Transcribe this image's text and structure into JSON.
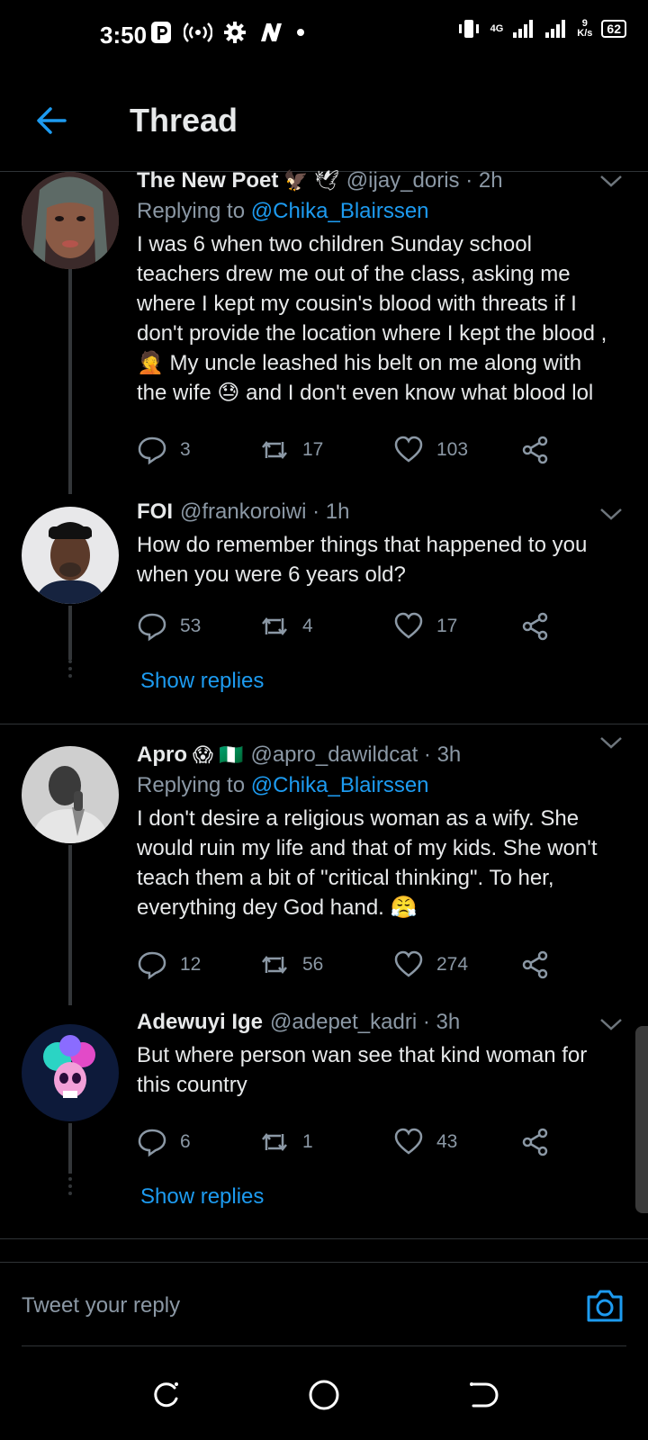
{
  "status_bar": {
    "time": "3:50",
    "left_icons": [
      "p-app-icon",
      "hotspot-icon",
      "settings-icon",
      "n-app-icon",
      "dot"
    ],
    "network": "4G",
    "speed_value": "9",
    "speed_unit": "K/s",
    "battery": "62"
  },
  "header": {
    "title": "Thread"
  },
  "tweets": [
    {
      "name": "The New Poet",
      "badges": "🦅 🕊",
      "handle": "@ijay_doris · 2h",
      "replying_prefix": "Replying to ",
      "replying_to": "@Chika_Blairssen",
      "text_lines": [
        "I was 6 when two children Sunday school",
        "teachers drew me out of the class, asking me",
        "where I kept my cousin's blood with threats if I",
        "don't provide the location where I kept the blood ,",
        "🤦 My uncle leashed his belt on me along with",
        "the wife 😓 and I don't even know what blood lol"
      ],
      "replies": "3",
      "retweets": "17",
      "likes": "103"
    },
    {
      "name": "FOI",
      "badges": "",
      "handle": "@frankoroiwi · 1h",
      "text_lines": [
        "How do remember things that happened to you",
        "when you were 6 years old?"
      ],
      "replies": "53",
      "retweets": "4",
      "likes": "17",
      "show_replies": "Show replies"
    },
    {
      "name": "Apro",
      "badges": "😱 🇳🇬",
      "handle": "@apro_dawildcat · 3h",
      "replying_prefix": "Replying to ",
      "replying_to": "@Chika_Blairssen",
      "text_lines": [
        "I don't desire a religious woman as a wify. She",
        "would ruin my life and that of my kids. She won't",
        "teach them a bit of \"critical thinking\". To her,",
        "everything dey God hand. 😤"
      ],
      "replies": "12",
      "retweets": "56",
      "likes": "274"
    },
    {
      "name": "Adewuyi Ige",
      "badges": "",
      "handle": "@adepet_kadri · 3h",
      "text_lines": [
        "But where person wan see that kind woman for",
        "this country"
      ],
      "replies": "6",
      "retweets": "1",
      "likes": "43",
      "show_replies": "Show replies"
    }
  ],
  "compose": {
    "placeholder": "Tweet your reply"
  },
  "colors": {
    "accent": "#1d9bf0",
    "background": "#000000",
    "muted": "#8b98a5"
  }
}
